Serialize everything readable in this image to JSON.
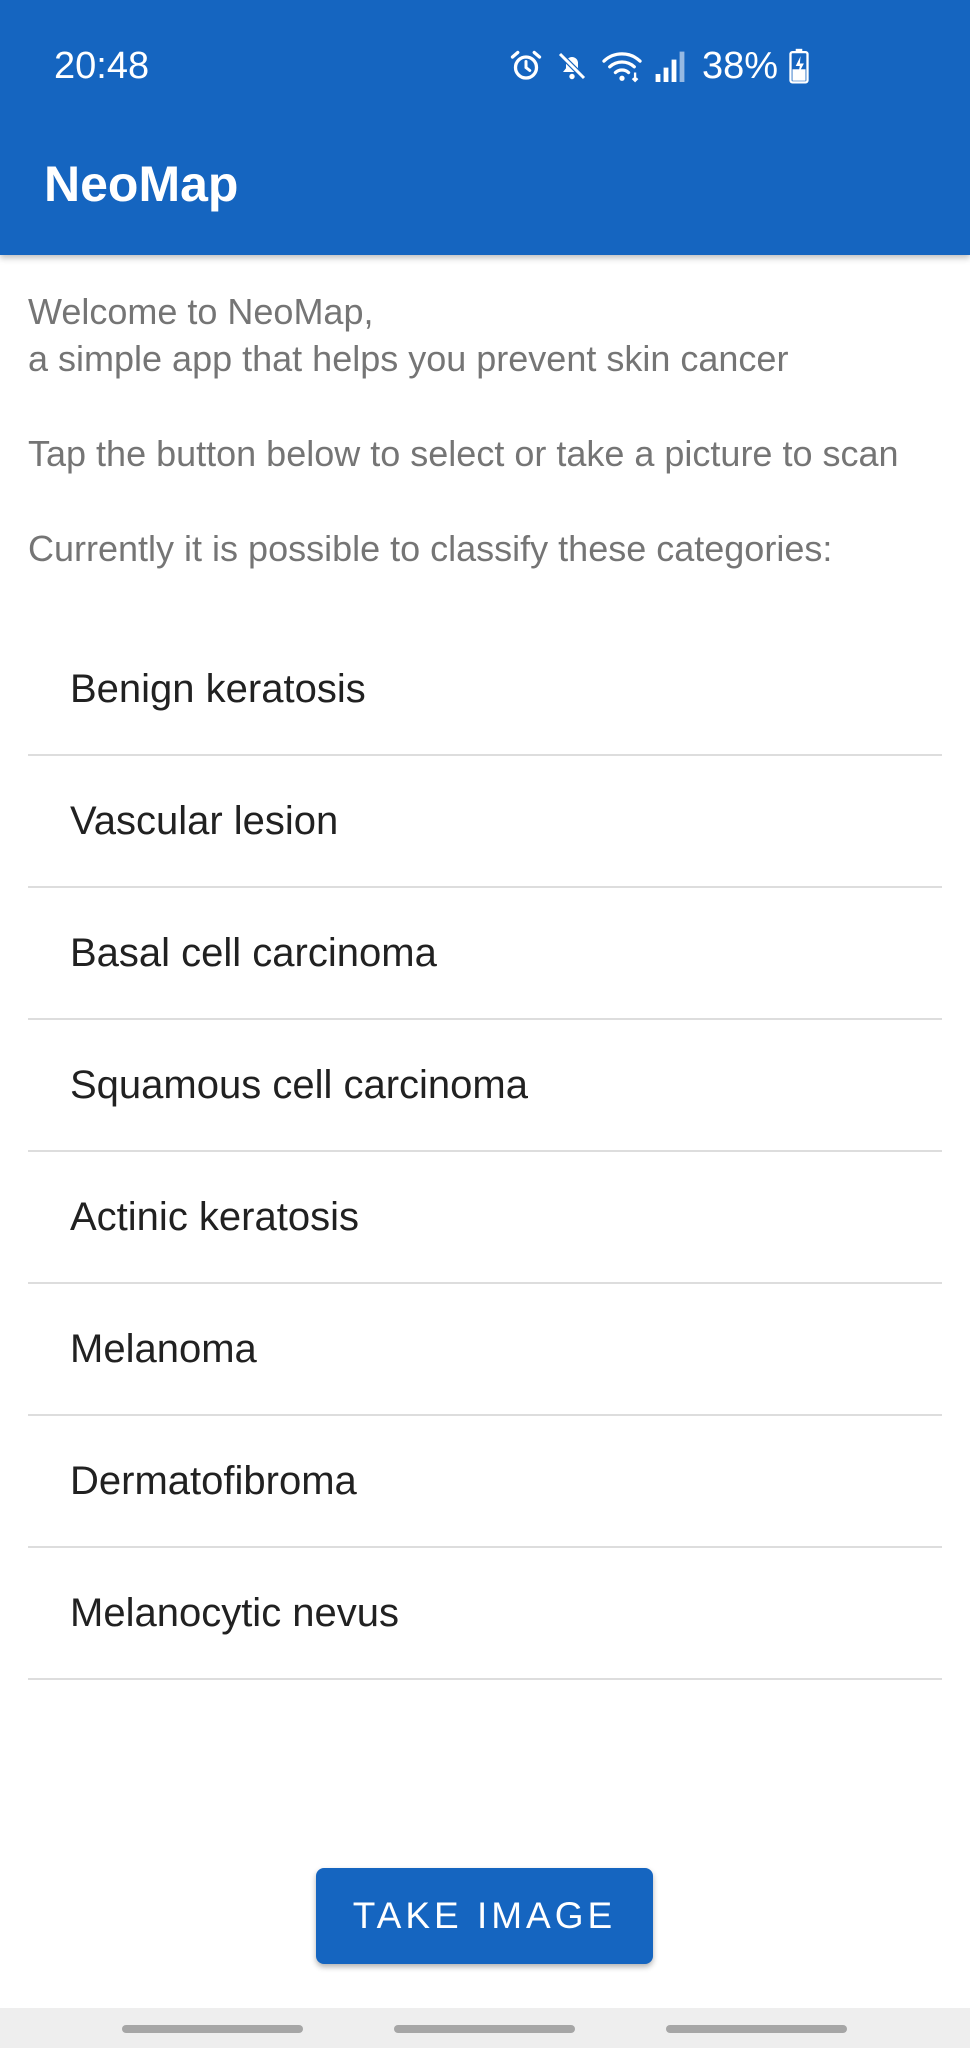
{
  "status_bar": {
    "time": "20:48",
    "battery": "38%",
    "icons": [
      "alarm-icon",
      "mute-icon",
      "wifi-icon",
      "signal-icon",
      "battery-icon"
    ]
  },
  "app_bar": {
    "title": "NeoMap",
    "color": "#1565c0"
  },
  "intro": {
    "welcome": "Welcome to NeoMap,\na simple app that helps you prevent skin cancer",
    "instruction": "Tap the button below to select or take a picture to scan",
    "categories_heading": "Currently it is possible to classify these categories:"
  },
  "categories": [
    "Benign keratosis",
    "Vascular lesion",
    "Basal cell carcinoma",
    "Squamous cell carcinoma",
    "Actinic keratosis",
    "Melanoma",
    "Dermatofibroma",
    "Melanocytic nevus"
  ],
  "actions": {
    "take_image_label": "TAKE IMAGE"
  }
}
